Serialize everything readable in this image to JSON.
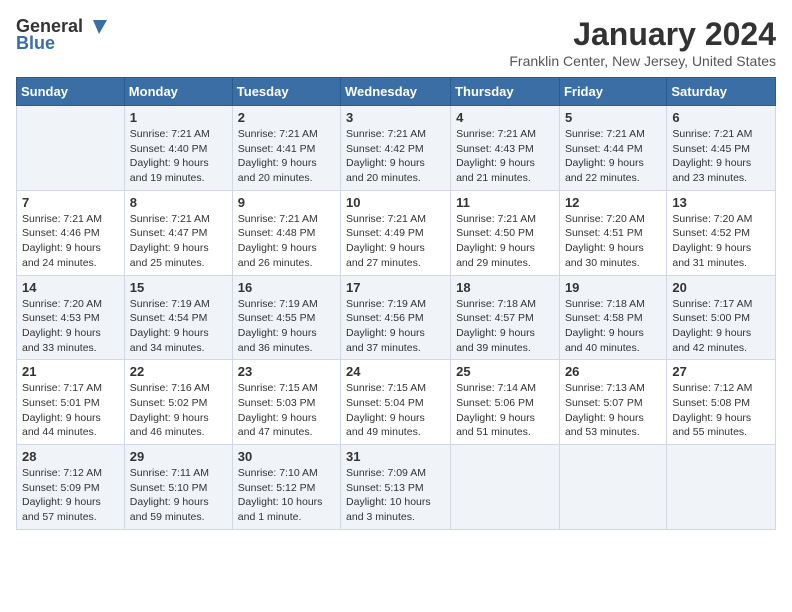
{
  "logo": {
    "general": "General",
    "blue": "Blue"
  },
  "header": {
    "month_title": "January 2024",
    "location": "Franklin Center, New Jersey, United States"
  },
  "days_of_week": [
    "Sunday",
    "Monday",
    "Tuesday",
    "Wednesday",
    "Thursday",
    "Friday",
    "Saturday"
  ],
  "weeks": [
    [
      {
        "day": "",
        "info": ""
      },
      {
        "day": "1",
        "info": "Sunrise: 7:21 AM\nSunset: 4:40 PM\nDaylight: 9 hours\nand 19 minutes."
      },
      {
        "day": "2",
        "info": "Sunrise: 7:21 AM\nSunset: 4:41 PM\nDaylight: 9 hours\nand 20 minutes."
      },
      {
        "day": "3",
        "info": "Sunrise: 7:21 AM\nSunset: 4:42 PM\nDaylight: 9 hours\nand 20 minutes."
      },
      {
        "day": "4",
        "info": "Sunrise: 7:21 AM\nSunset: 4:43 PM\nDaylight: 9 hours\nand 21 minutes."
      },
      {
        "day": "5",
        "info": "Sunrise: 7:21 AM\nSunset: 4:44 PM\nDaylight: 9 hours\nand 22 minutes."
      },
      {
        "day": "6",
        "info": "Sunrise: 7:21 AM\nSunset: 4:45 PM\nDaylight: 9 hours\nand 23 minutes."
      }
    ],
    [
      {
        "day": "7",
        "info": "Sunrise: 7:21 AM\nSunset: 4:46 PM\nDaylight: 9 hours\nand 24 minutes."
      },
      {
        "day": "8",
        "info": "Sunrise: 7:21 AM\nSunset: 4:47 PM\nDaylight: 9 hours\nand 25 minutes."
      },
      {
        "day": "9",
        "info": "Sunrise: 7:21 AM\nSunset: 4:48 PM\nDaylight: 9 hours\nand 26 minutes."
      },
      {
        "day": "10",
        "info": "Sunrise: 7:21 AM\nSunset: 4:49 PM\nDaylight: 9 hours\nand 27 minutes."
      },
      {
        "day": "11",
        "info": "Sunrise: 7:21 AM\nSunset: 4:50 PM\nDaylight: 9 hours\nand 29 minutes."
      },
      {
        "day": "12",
        "info": "Sunrise: 7:20 AM\nSunset: 4:51 PM\nDaylight: 9 hours\nand 30 minutes."
      },
      {
        "day": "13",
        "info": "Sunrise: 7:20 AM\nSunset: 4:52 PM\nDaylight: 9 hours\nand 31 minutes."
      }
    ],
    [
      {
        "day": "14",
        "info": "Sunrise: 7:20 AM\nSunset: 4:53 PM\nDaylight: 9 hours\nand 33 minutes."
      },
      {
        "day": "15",
        "info": "Sunrise: 7:19 AM\nSunset: 4:54 PM\nDaylight: 9 hours\nand 34 minutes."
      },
      {
        "day": "16",
        "info": "Sunrise: 7:19 AM\nSunset: 4:55 PM\nDaylight: 9 hours\nand 36 minutes."
      },
      {
        "day": "17",
        "info": "Sunrise: 7:19 AM\nSunset: 4:56 PM\nDaylight: 9 hours\nand 37 minutes."
      },
      {
        "day": "18",
        "info": "Sunrise: 7:18 AM\nSunset: 4:57 PM\nDaylight: 9 hours\nand 39 minutes."
      },
      {
        "day": "19",
        "info": "Sunrise: 7:18 AM\nSunset: 4:58 PM\nDaylight: 9 hours\nand 40 minutes."
      },
      {
        "day": "20",
        "info": "Sunrise: 7:17 AM\nSunset: 5:00 PM\nDaylight: 9 hours\nand 42 minutes."
      }
    ],
    [
      {
        "day": "21",
        "info": "Sunrise: 7:17 AM\nSunset: 5:01 PM\nDaylight: 9 hours\nand 44 minutes."
      },
      {
        "day": "22",
        "info": "Sunrise: 7:16 AM\nSunset: 5:02 PM\nDaylight: 9 hours\nand 46 minutes."
      },
      {
        "day": "23",
        "info": "Sunrise: 7:15 AM\nSunset: 5:03 PM\nDaylight: 9 hours\nand 47 minutes."
      },
      {
        "day": "24",
        "info": "Sunrise: 7:15 AM\nSunset: 5:04 PM\nDaylight: 9 hours\nand 49 minutes."
      },
      {
        "day": "25",
        "info": "Sunrise: 7:14 AM\nSunset: 5:06 PM\nDaylight: 9 hours\nand 51 minutes."
      },
      {
        "day": "26",
        "info": "Sunrise: 7:13 AM\nSunset: 5:07 PM\nDaylight: 9 hours\nand 53 minutes."
      },
      {
        "day": "27",
        "info": "Sunrise: 7:12 AM\nSunset: 5:08 PM\nDaylight: 9 hours\nand 55 minutes."
      }
    ],
    [
      {
        "day": "28",
        "info": "Sunrise: 7:12 AM\nSunset: 5:09 PM\nDaylight: 9 hours\nand 57 minutes."
      },
      {
        "day": "29",
        "info": "Sunrise: 7:11 AM\nSunset: 5:10 PM\nDaylight: 9 hours\nand 59 minutes."
      },
      {
        "day": "30",
        "info": "Sunrise: 7:10 AM\nSunset: 5:12 PM\nDaylight: 10 hours\nand 1 minute."
      },
      {
        "day": "31",
        "info": "Sunrise: 7:09 AM\nSunset: 5:13 PM\nDaylight: 10 hours\nand 3 minutes."
      },
      {
        "day": "",
        "info": ""
      },
      {
        "day": "",
        "info": ""
      },
      {
        "day": "",
        "info": ""
      }
    ]
  ]
}
